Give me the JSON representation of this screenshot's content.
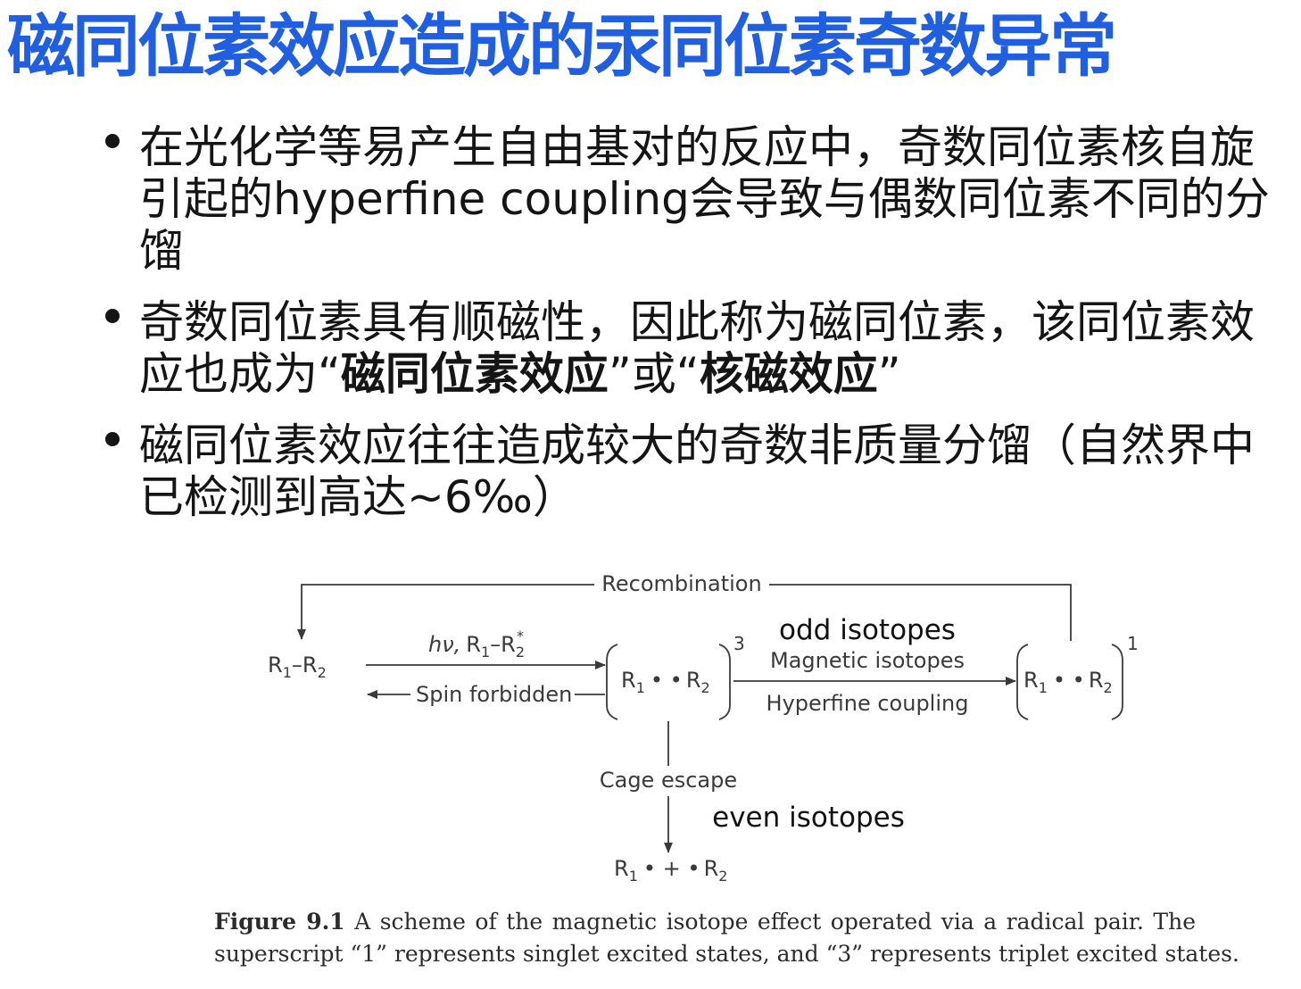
{
  "title": "磁同位素效应造成的汞同位素奇数异常",
  "bullets": [
    {
      "text_before": "在光化学等易产生自由基对的反应中，奇数同位素核自旋引起的hyperfine coupling会导致与偶数同位素不同的分馏",
      "emphasis_1": "",
      "text_middle": "",
      "emphasis_2": "",
      "text_after": ""
    },
    {
      "text_before": "奇数同位素具有顺磁性，因此称为磁同位素，该同位素效应也成为“",
      "emphasis_1": "磁同位素效应",
      "text_middle": "”或“",
      "emphasis_2": "核磁效应",
      "text_after": "”"
    },
    {
      "text_before": "磁同位素效应往往造成较大的奇数非质量分馏（自然界中已检测到高达~6‰）",
      "emphasis_1": "",
      "text_middle": "",
      "emphasis_2": "",
      "text_after": ""
    }
  ],
  "diagram": {
    "recombination": "Recombination",
    "reactant": {
      "r1": "R",
      "r1_sub": "1",
      "dash": "–",
      "r2": "R",
      "r2_sub": "2"
    },
    "excitation": {
      "hv": "hν,",
      "r1": "R",
      "r1_sub": "1",
      "dash": "–",
      "r2": "R",
      "r2_sub": "2",
      "star": "*"
    },
    "spin_forbidden": "Spin forbidden",
    "triplet_pair": {
      "r1": "R",
      "r1_sub": "1",
      "dots": "• •",
      "r2": "R",
      "r2_sub": "2",
      "sup": "3"
    },
    "singlet_pair": {
      "r1": "R",
      "r1_sub": "1",
      "dots": "• •",
      "r2": "R",
      "r2_sub": "2",
      "sup": "1"
    },
    "odd_isotopes": "odd isotopes",
    "magnetic_isotopes": "Magnetic isotopes",
    "hyperfine_coupling": "Hyperfine coupling",
    "cage_escape": "Cage escape",
    "even_isotopes": "even isotopes",
    "products": {
      "r1": "R",
      "r1_sub": "1",
      "mid": "• + •",
      "r2": "R",
      "r2_sub": "2"
    }
  },
  "caption": {
    "label": "Figure 9.1",
    "line1": "A scheme of the magnetic isotope effect operated via a radical pair. The",
    "line2": "superscript “1” represents singlet excited states, and “3” represents triplet excited states."
  },
  "colors": {
    "title": "#1f5fe0",
    "text": "#151515",
    "diagram": "#3a3a3a"
  }
}
